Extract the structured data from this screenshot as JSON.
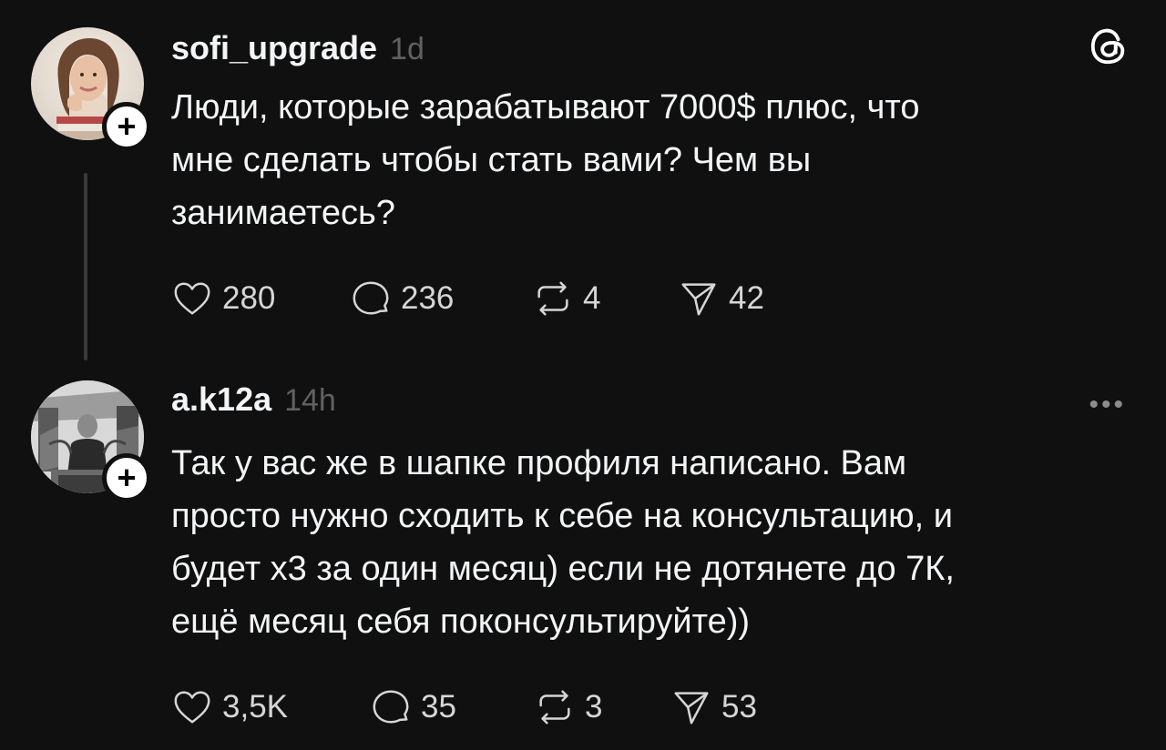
{
  "posts": [
    {
      "username": "sofi_upgrade",
      "time": "1d",
      "avatar": "avatar-woman-photo",
      "follow_symbol": "+",
      "text": "Люди, которые зарабатывают 7000$ плюс, что\nмне сделать чтобы стать вами? Чем вы\nзанимаетесь?",
      "likes": "280",
      "comments": "236",
      "reposts": "4",
      "shares": "42",
      "corner_icon": "threads-logo-icon"
    },
    {
      "username": "a.k12a",
      "time": "14h",
      "avatar": "avatar-man-photo-bw",
      "follow_symbol": "+",
      "text": "Так у вас же в шапке профиля написано. Вам\nпросто нужно сходить к себе на консультацию, и\nбудет х3 за один месяц) если не дотянете до 7К,\nещё месяц себя поконсультируйте))",
      "likes": "3,5K",
      "comments": "35",
      "reposts": "3",
      "shares": "53",
      "corner_icon": "more-options-icon"
    }
  ],
  "colors": {
    "background": "#101010",
    "text": "#f3f5f7",
    "muted": "#616161",
    "icon": "#d6d6d6",
    "thread_line": "#3a3a3a"
  }
}
